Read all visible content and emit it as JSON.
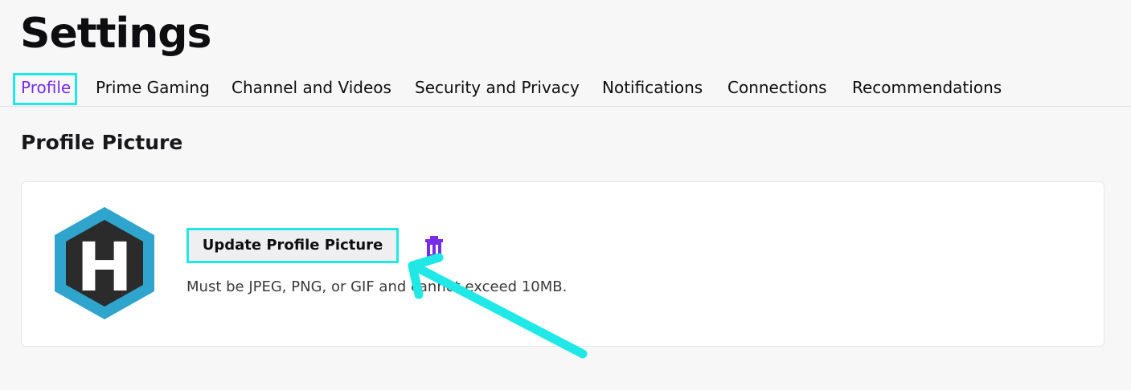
{
  "header": {
    "title": "Settings"
  },
  "tabs": [
    {
      "label": "Profile",
      "active": true
    },
    {
      "label": "Prime Gaming",
      "active": false
    },
    {
      "label": "Channel and Videos",
      "active": false
    },
    {
      "label": "Security and Privacy",
      "active": false
    },
    {
      "label": "Notifications",
      "active": false
    },
    {
      "label": "Connections",
      "active": false
    },
    {
      "label": "Recommendations",
      "active": false
    }
  ],
  "profile_picture": {
    "section_title": "Profile Picture",
    "avatar_letter": "H",
    "update_button_label": "Update Profile Picture",
    "delete_icon": "trash-icon",
    "help_text": "Must be JPEG, PNG, or GIF and cannot exceed 10MB."
  },
  "colors": {
    "accent": "#772ce8",
    "annotation": "#1fe8e6",
    "avatar_outer": "#2fa4cc",
    "avatar_inner": "#2b2b2b"
  }
}
